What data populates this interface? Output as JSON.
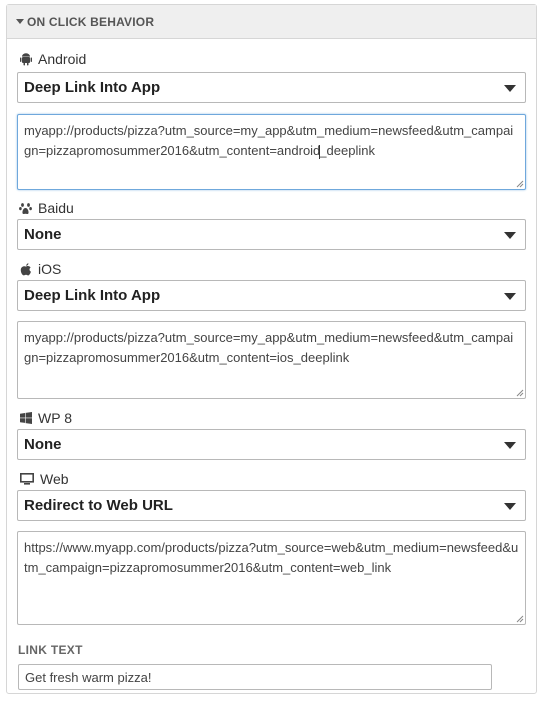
{
  "section": {
    "title": "ON CLICK BEHAVIOR"
  },
  "platforms": {
    "android": {
      "label": "Android",
      "action": "Deep Link Into App",
      "url_before_cursor": "myapp://products/pizza?utm_source=my_app&utm_medium=newsfeed&utm_campaign=pizzapromosummer2016&utm_content=android",
      "url_after_cursor": "_deeplink"
    },
    "baidu": {
      "label": "Baidu",
      "action": "None"
    },
    "ios": {
      "label": "iOS",
      "action": "Deep Link Into App",
      "url": "myapp://products/pizza?utm_source=my_app&utm_medium=newsfeed&utm_campaign=pizzapromosummer2016&utm_content=ios_deeplink"
    },
    "wp8": {
      "label": "WP 8",
      "action": "None"
    },
    "web": {
      "label": "Web",
      "action": "Redirect to Web URL",
      "url": "https://www.myapp.com/products/pizza?utm_source=web&utm_medium=newsfeed&utm_campaign=pizzapromosummer2016&utm_content=web_link"
    }
  },
  "link_text": {
    "label": "LINK TEXT",
    "value": "Get fresh warm pizza!"
  },
  "icons": [
    "android-icon",
    "paw-icon",
    "apple-icon",
    "windows-icon",
    "monitor-icon"
  ]
}
